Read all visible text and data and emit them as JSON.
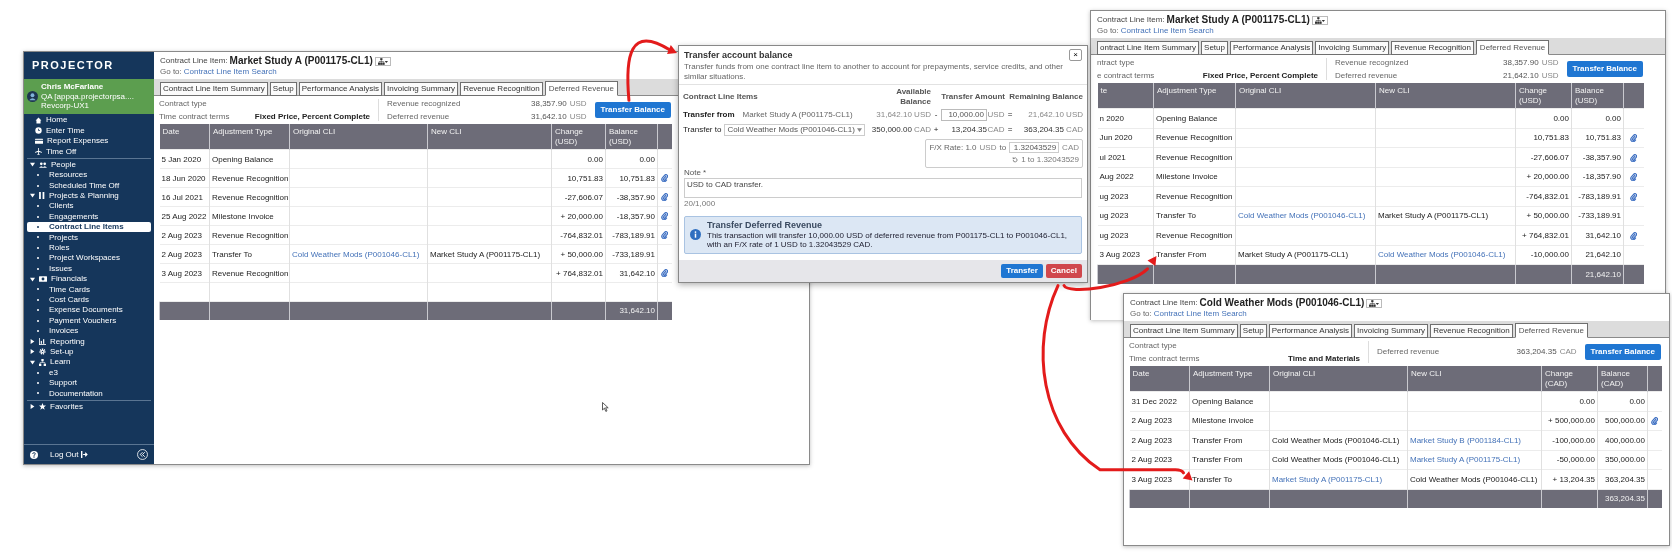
{
  "main_window": {
    "sidebar": {
      "logo": "PROJECTOR",
      "user": {
        "name": "Chris McFarlane",
        "org": "QA [appqa.projectorpsa....",
        "company": "Revcorp-UX1"
      },
      "items": [
        {
          "kind": "link",
          "label": "Home"
        },
        {
          "kind": "link",
          "label": "Enter Time"
        },
        {
          "kind": "link",
          "label": "Report Expenses"
        },
        {
          "kind": "link",
          "label": "Time Off"
        },
        {
          "kind": "section",
          "label": "People",
          "expanded": true,
          "children": [
            {
              "label": "Resources",
              "selected": false
            },
            {
              "label": "Scheduled Time Off",
              "selected": false
            }
          ]
        },
        {
          "kind": "section",
          "label": "Projects & Planning",
          "expanded": true,
          "children": [
            {
              "label": "Clients",
              "selected": false
            },
            {
              "label": "Engagements",
              "selected": false
            },
            {
              "label": "Contract Line Items",
              "selected": true
            },
            {
              "label": "Projects",
              "selected": false
            },
            {
              "label": "Roles",
              "selected": false
            },
            {
              "label": "Project Workspaces",
              "selected": false
            },
            {
              "label": "Issues",
              "selected": false
            }
          ]
        },
        {
          "kind": "section",
          "label": "Financials",
          "expanded": true,
          "children": [
            {
              "label": "Time Cards",
              "selected": false
            },
            {
              "label": "Cost Cards",
              "selected": false
            },
            {
              "label": "Expense Documents",
              "selected": false
            },
            {
              "label": "Payment Vouchers",
              "selected": false
            },
            {
              "label": "Invoices",
              "selected": false
            }
          ]
        },
        {
          "kind": "section",
          "label": "Reporting",
          "expanded": false
        },
        {
          "kind": "section",
          "label": "Set-up",
          "expanded": false
        },
        {
          "kind": "section",
          "label": "Learn",
          "expanded": true,
          "children": [
            {
              "label": "e3",
              "selected": false
            },
            {
              "label": "Support",
              "selected": false
            },
            {
              "label": "Documentation",
              "selected": false
            }
          ]
        },
        {
          "kind": "section",
          "label": "Favorites",
          "expanded": false
        }
      ],
      "logout": "Log Out"
    },
    "page": {
      "label": "Contract Line Item:",
      "title": "Market Study A (P001175-CL1)",
      "goto_label": "Go to:",
      "goto_link": "Contract Line Item Search",
      "tabs": [
        {
          "label": "Contract Line Item Summary",
          "selected": false
        },
        {
          "label": "Setup",
          "selected": false
        },
        {
          "label": "Performance Analysis",
          "selected": false
        },
        {
          "label": "Invoicing Summary",
          "selected": false
        },
        {
          "label": "Revenue Recognition",
          "selected": false
        },
        {
          "label": "Deferred Revenue",
          "selected": true
        }
      ],
      "contract_type_label": "Contract type",
      "terms_label": "Time contract terms",
      "terms_value": "Fixed Price, Percent Complete",
      "summary": [
        {
          "label": "Revenue recognized",
          "value": "38,357.90",
          "currency": "USD"
        },
        {
          "label": "Deferred revenue",
          "value": "31,642.10",
          "currency": "USD"
        }
      ],
      "button": "Transfer Balance",
      "columns": [
        "Date",
        "Adjustment Type",
        "Original CLI",
        "New CLI",
        "Change (USD)",
        "Balance (USD)"
      ],
      "rows": [
        {
          "date": "5 Jan 2020",
          "type": "Opening Balance",
          "change": "0.00",
          "balance": "0.00",
          "attachment": false
        },
        {
          "date": "18 Jun 2020",
          "type": "Revenue Recognition",
          "change": "10,751.83",
          "balance": "10,751.83",
          "attachment": true
        },
        {
          "date": "16 Jul 2021",
          "type": "Revenue Recognition",
          "change": "-27,606.07",
          "balance": "-38,357.90",
          "attachment": true
        },
        {
          "date": "25 Aug 2022",
          "type": "Milestone Invoice",
          "change": "+ 20,000.00",
          "balance": "-18,357.90",
          "attachment": true
        },
        {
          "date": "2 Aug 2023",
          "type": "Revenue Recognition",
          "change": "-764,832.01",
          "balance": "-783,189.91",
          "attachment": true
        },
        {
          "date": "2 Aug 2023",
          "type": "Transfer To",
          "original": "Cold Weather Mods (P001046-CL1)",
          "original_link": true,
          "new": "Market Study A (P001175-CL1)",
          "new_link": false,
          "change": "+ 50,000.00",
          "balance": "-733,189.91",
          "attachment": false
        },
        {
          "date": "3 Aug 2023",
          "type": "Revenue Recognition",
          "change": "+ 764,832.01",
          "balance": "31,642.10",
          "attachment": true
        }
      ],
      "spacer_row": true,
      "total": "31,642.10"
    }
  },
  "dialog": {
    "title": "Transfer account balance",
    "close": "×",
    "description": "Transfer funds from one contract line item to another to account for prepayments, service credits, and other similar situations.",
    "headers": [
      "Contract Line Items",
      "Available Balance",
      "Transfer Amount",
      "Remaining Balance"
    ],
    "from": {
      "label": "Transfer from",
      "cli": "Market Study A (P001175-CL1)",
      "available": "31,642.10",
      "available_currency": "USD",
      "operator": "-",
      "amount": "10,000.00",
      "amount_currency": "USD",
      "equals": "=",
      "remaining": "21,642.10",
      "remaining_currency": "USD"
    },
    "to": {
      "label": "Transfer to",
      "cli": "Cold Weather Mods (P001046-CL1)",
      "available": "350,000.00",
      "available_currency": "CAD",
      "operator": "+",
      "amount": "13,204.35",
      "amount_currency": "CAD",
      "equals": "=",
      "remaining": "363,204.35",
      "remaining_currency": "CAD"
    },
    "fx": {
      "label": "F/X Rate: 1.0",
      "from_currency": "USD",
      "to_word": "to",
      "rate": "1.32043529",
      "to_currency": "CAD",
      "reset": "1 to 1.32043529"
    },
    "note": {
      "label": "Note *",
      "value": "USD to CAD transfer.",
      "counter": "20/1,000"
    },
    "alert": {
      "title": "Transfer Deferred Revenue",
      "text": "This transaction will transfer 10,000.00 USD of deferred revenue from P001175-CL1 to P001046-CL1, with an F/X rate of 1 USD to 1.32043529 CAD."
    },
    "buttons": [
      {
        "label": "Transfer",
        "kind": "primary"
      },
      {
        "label": "Cancel",
        "kind": "danger"
      }
    ]
  },
  "side_windows": [
    {
      "label": "Contract Line Item:",
      "title": "Market Study A (P001175-CL1)",
      "goto_label": "Go to:",
      "goto_link": "Contract Line Item Search",
      "tabs": [
        {
          "label": "ontract Line Item Summary",
          "selected": false
        },
        {
          "label": "Setup",
          "selected": false
        },
        {
          "label": "Performance Analysis",
          "selected": false
        },
        {
          "label": "Invoicing Summary",
          "selected": false
        },
        {
          "label": "Revenue Recognition",
          "selected": false
        },
        {
          "label": "Deferred Revenue",
          "selected": true
        }
      ],
      "contract_type_label": "ntract type",
      "terms_label": "e contract terms",
      "terms_value": "Fixed Price, Percent Complete",
      "summary": [
        {
          "label": "Revenue recognized",
          "value": "38,357.90",
          "currency": "USD"
        },
        {
          "label": "Deferred revenue",
          "value": "21,642.10",
          "currency": "USD"
        }
      ],
      "button": "Transfer Balance",
      "columns": [
        "te",
        "Adjustment Type",
        "Original CLI",
        "New CLI",
        "Change (USD)",
        "Balance (USD)"
      ],
      "rows": [
        {
          "date": "n 2020",
          "type": "Opening Balance",
          "change": "0.00",
          "balance": "0.00",
          "attachment": false
        },
        {
          "date": "Jun 2020",
          "type": "Revenue Recognition",
          "change": "10,751.83",
          "balance": "10,751.83",
          "attachment": true
        },
        {
          "date": "ul 2021",
          "type": "Revenue Recognition",
          "change": "-27,606.07",
          "balance": "-38,357.90",
          "attachment": true
        },
        {
          "date": "Aug 2022",
          "type": "Milestone Invoice",
          "change": "+ 20,000.00",
          "balance": "-18,357.90",
          "attachment": true
        },
        {
          "date": "ug 2023",
          "type": "Revenue Recognition",
          "change": "-764,832.01",
          "balance": "-783,189.91",
          "attachment": true
        },
        {
          "date": "ug 2023",
          "type": "Transfer To",
          "original": "Cold Weather Mods (P001046-CL1)",
          "original_link": true,
          "new": "Market Study A (P001175-CL1)",
          "new_link": false,
          "change": "+ 50,000.00",
          "balance": "-733,189.91",
          "attachment": false
        },
        {
          "date": "ug 2023",
          "type": "Revenue Recognition",
          "change": "+ 764,832.01",
          "balance": "31,642.10",
          "attachment": true
        },
        {
          "date": "3 Aug 2023",
          "type": "Transfer From",
          "original": "Market Study A (P001175-CL1)",
          "original_link": false,
          "new": "Cold Weather Mods (P001046-CL1)",
          "new_link": true,
          "change": "-10,000.00",
          "balance": "21,642.10",
          "attachment": false
        }
      ],
      "spacer_row": false,
      "total": "21,642.10"
    },
    {
      "label": "Contract Line Item:",
      "title": "Cold Weather Mods (P001046-CL1)",
      "goto_label": "Go to:",
      "goto_link": "Contract Line Item Search",
      "tabs": [
        {
          "label": "Contract Line Item Summary",
          "selected": false
        },
        {
          "label": "Setup",
          "selected": false
        },
        {
          "label": "Performance Analysis",
          "selected": false
        },
        {
          "label": "Invoicing Summary",
          "selected": false
        },
        {
          "label": "Revenue Recognition",
          "selected": false
        },
        {
          "label": "Deferred Revenue",
          "selected": true
        }
      ],
      "contract_type_label": "Contract type",
      "terms_label": "Time contract terms",
      "terms_value": "Time and Materials",
      "summary": [
        {
          "label": "Deferred revenue",
          "value": "363,204.35",
          "currency": "CAD"
        }
      ],
      "button": "Transfer Balance",
      "columns": [
        "Date",
        "Adjustment Type",
        "Original CLI",
        "New CLI",
        "Change (CAD)",
        "Balance (CAD)"
      ],
      "rows": [
        {
          "date": "31 Dec 2022",
          "type": "Opening Balance",
          "change": "0.00",
          "balance": "0.00",
          "attachment": false
        },
        {
          "date": "2 Aug 2023",
          "type": "Milestone Invoice",
          "change": "+ 500,000.00",
          "balance": "500,000.00",
          "attachment": true
        },
        {
          "date": "2 Aug 2023",
          "type": "Transfer From",
          "original": "Cold Weather Mods (P001046-CL1)",
          "original_link": false,
          "new": "Market Study B (P001184-CL1)",
          "new_link": true,
          "change": "-100,000.00",
          "balance": "400,000.00",
          "attachment": false
        },
        {
          "date": "2 Aug 2023",
          "type": "Transfer From",
          "original": "Cold Weather Mods (P001046-CL1)",
          "original_link": false,
          "new": "Market Study A (P001175-CL1)",
          "new_link": true,
          "change": "-50,000.00",
          "balance": "350,000.00",
          "attachment": false
        },
        {
          "date": "3 Aug 2023",
          "type": "Transfer To",
          "original": "Market Study A (P001175-CL1)",
          "original_link": true,
          "new": "Cold Weather Mods (P001046-CL1)",
          "new_link": false,
          "change": "+ 13,204.35",
          "balance": "363,204.35",
          "attachment": false
        }
      ],
      "spacer_row": false,
      "total": "363,204.35"
    }
  ]
}
